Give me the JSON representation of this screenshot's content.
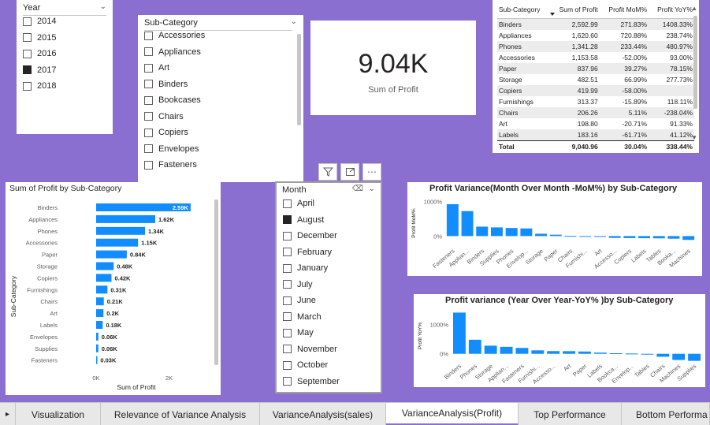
{
  "year_slicer": {
    "title": "Year",
    "items": [
      {
        "label": "2014",
        "checked": false
      },
      {
        "label": "2015",
        "checked": false
      },
      {
        "label": "2016",
        "checked": false
      },
      {
        "label": "2017",
        "checked": true
      },
      {
        "label": "2018",
        "checked": false
      }
    ]
  },
  "subcat_slicer": {
    "title": "Sub-Category",
    "items": [
      {
        "label": "Accessories"
      },
      {
        "label": "Appliances"
      },
      {
        "label": "Art"
      },
      {
        "label": "Binders"
      },
      {
        "label": "Bookcases"
      },
      {
        "label": "Chairs"
      },
      {
        "label": "Copiers"
      },
      {
        "label": "Envelopes"
      },
      {
        "label": "Fasteners"
      }
    ]
  },
  "kpi": {
    "value": "9.04K",
    "label": "Sum of Profit"
  },
  "matrix": {
    "headers": [
      "Sub-Category",
      "Sum of Profit",
      "Profit MoM%",
      "Profit YoY%"
    ],
    "rows": [
      [
        "Binders",
        "2,592.99",
        "271.83%",
        "1408.33%"
      ],
      [
        "Appliances",
        "1,620.60",
        "720.88%",
        "238.74%"
      ],
      [
        "Phones",
        "1,341.28",
        "233.44%",
        "480.97%"
      ],
      [
        "Accessories",
        "1,153.58",
        "-52.00%",
        "93.00%"
      ],
      [
        "Paper",
        "837.96",
        "39.27%",
        "78.15%"
      ],
      [
        "Storage",
        "482.51",
        "66.99%",
        "277.73%"
      ],
      [
        "Copiers",
        "419.99",
        "-58.00%",
        ""
      ],
      [
        "Furnishings",
        "313.37",
        "-15.89%",
        "118.11%"
      ],
      [
        "Chairs",
        "206.26",
        "5.11%",
        "-238.04%"
      ],
      [
        "Art",
        "198.80",
        "-20.71%",
        "91.33%"
      ],
      [
        "Labels",
        "183.16",
        "-61.71%",
        "41.12%"
      ]
    ],
    "total": [
      "Total",
      "9,040.96",
      "30.04%",
      "338.44%"
    ]
  },
  "month_slicer": {
    "title": "Month",
    "items": [
      {
        "label": "April",
        "checked": false
      },
      {
        "label": "August",
        "checked": true
      },
      {
        "label": "December",
        "checked": false
      },
      {
        "label": "February",
        "checked": false
      },
      {
        "label": "January",
        "checked": false
      },
      {
        "label": "July",
        "checked": false
      },
      {
        "label": "June",
        "checked": false
      },
      {
        "label": "March",
        "checked": false
      },
      {
        "label": "May",
        "checked": false
      },
      {
        "label": "November",
        "checked": false
      },
      {
        "label": "October",
        "checked": false
      },
      {
        "label": "September",
        "checked": false
      }
    ]
  },
  "chart_data": [
    {
      "type": "bar",
      "orientation": "horizontal",
      "title": "Sum of Profit by Sub-Category",
      "xlabel": "Sum of Profit",
      "ylabel": "Sub-Category",
      "xticks": [
        "0K",
        "2K"
      ],
      "xlim": [
        0,
        2700
      ],
      "categories": [
        "Binders",
        "Appliances",
        "Phones",
        "Accessories",
        "Paper",
        "Storage",
        "Copiers",
        "Furnishings",
        "Chairs",
        "Art",
        "Labels",
        "Envelopes",
        "Supplies",
        "Fasteners"
      ],
      "values": [
        2590,
        1620,
        1340,
        1150,
        840,
        480,
        420,
        310,
        210,
        200,
        180,
        60,
        60,
        30
      ],
      "data_labels": [
        "2.59K",
        "1.62K",
        "1.34K",
        "1.15K",
        "0.84K",
        "0.48K",
        "0.42K",
        "0.31K",
        "0.21K",
        "0.2K",
        "0.18K",
        "0.06K",
        "0.06K",
        "0.03K"
      ],
      "color": "#118dff"
    },
    {
      "type": "bar",
      "title": "Profit Variance(Month Over Month -MoM%) by Sub-Category",
      "ylabel": "Profit MoM%",
      "yticks": [
        "1000%",
        "0%"
      ],
      "ylim": [
        -150,
        1100
      ],
      "categories": [
        "Fasteners",
        "Applian...",
        "Binders",
        "Supplies",
        "Phones",
        "Envelop...",
        "Storage",
        "Paper",
        "Chairs",
        "Furnishi...",
        "Art",
        "Accesso...",
        "Copiers",
        "Labels",
        "Tables",
        "Booka...",
        "Machines"
      ],
      "values": [
        920,
        720,
        272,
        250,
        233,
        220,
        67,
        39,
        5,
        -16,
        -21,
        -52,
        -58,
        -62,
        -65,
        -75,
        -110
      ],
      "color": "#118dff"
    },
    {
      "type": "bar",
      "title": "Profit variance (Year Over Year-YoY% )by Sub-Category",
      "ylabel": "Profit YoY%",
      "yticks": [
        "1000%",
        "0%"
      ],
      "ylim": [
        -250,
        1500
      ],
      "categories": [
        "Binders",
        "Phones",
        "Storage",
        "Applian...",
        "Fasteners",
        "Furnishi...",
        "Accesso...",
        "Art",
        "Paper",
        "Labels",
        "Bookca...",
        "Envelop...",
        "Tables",
        "Chairs",
        "Machines",
        "Supplies"
      ],
      "values": [
        1408,
        481,
        278,
        239,
        200,
        118,
        93,
        91,
        78,
        41,
        20,
        10,
        0,
        -100,
        -210,
        -240
      ],
      "color": "#118dff"
    }
  ],
  "tabs": [
    {
      "label": "Visualization"
    },
    {
      "label": "Relevance of Variance Analysis"
    },
    {
      "label": "VarianceAnalysis(sales)"
    },
    {
      "label": "VarianceAnalysis(Profit)",
      "active": true
    },
    {
      "label": "Top Performance"
    },
    {
      "label": "Bottom Performa"
    }
  ],
  "nav": {
    "prev_glyph": "▸"
  }
}
